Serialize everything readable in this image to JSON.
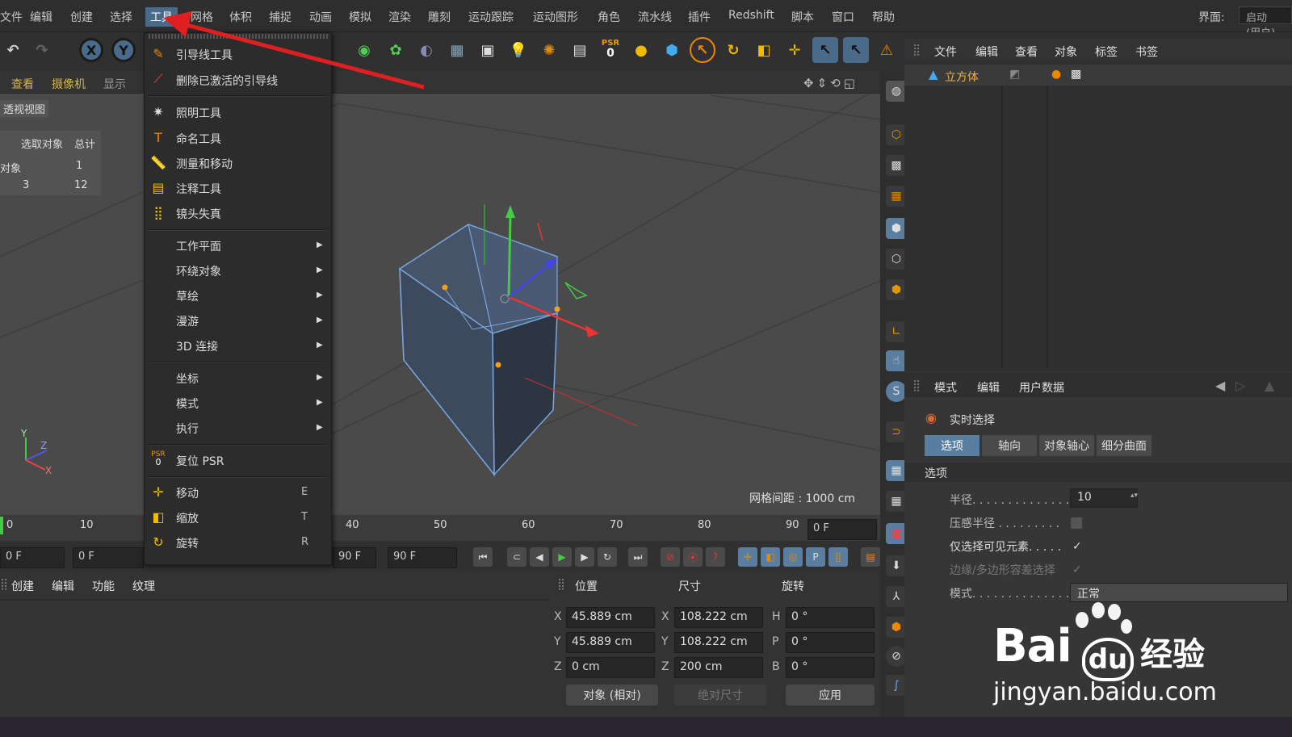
{
  "menubar": {
    "items": [
      "文件",
      "编辑",
      "创建",
      "选择",
      "工具",
      "网格",
      "体积",
      "捕捉",
      "动画",
      "模拟",
      "渲染",
      "雕刻",
      "运动跟踪",
      "运动图形",
      "角色",
      "流水线",
      "插件",
      "Redshift",
      "脚本",
      "窗口",
      "帮助"
    ],
    "interface_label": "界面:",
    "interface_value": "启动 (用户)"
  },
  "toolbar": {
    "psr_label": "PSR",
    "psr_value": "0"
  },
  "viewport": {
    "menu": [
      "查看",
      "摄像机",
      "显示"
    ],
    "view_name": "透视视图",
    "stats_header": [
      "选取对象",
      "总计"
    ],
    "stats_row1": [
      "对象",
      "1"
    ],
    "stats_row2": [
      "3",
      "12"
    ],
    "grid_label": "网格间距 : 1000 cm",
    "axis_labels": [
      "Y",
      "Z",
      "X"
    ]
  },
  "dropdown": {
    "group1": [
      {
        "label": "引导线工具"
      },
      {
        "label": "删除已激活的引导线"
      }
    ],
    "group2": [
      {
        "label": "照明工具"
      },
      {
        "label": "命名工具"
      },
      {
        "label": "测量和移动"
      },
      {
        "label": "注释工具"
      },
      {
        "label": "镜头失真"
      }
    ],
    "group3": [
      {
        "label": "工作平面"
      },
      {
        "label": "环绕对象"
      },
      {
        "label": "草绘"
      },
      {
        "label": "漫游"
      },
      {
        "label": "3D 连接"
      }
    ],
    "group4": [
      {
        "label": "坐标"
      },
      {
        "label": "模式"
      },
      {
        "label": "执行"
      }
    ],
    "reset_psr": "复位 PSR",
    "group5": [
      {
        "label": "移动",
        "key": "E"
      },
      {
        "label": "缩放",
        "key": "T"
      },
      {
        "label": "旋转",
        "key": "R"
      }
    ]
  },
  "object_manager": {
    "menu": [
      "文件",
      "编辑",
      "查看",
      "对象",
      "标签",
      "书签"
    ],
    "object_name": "立方体"
  },
  "attribute_manager": {
    "menu": [
      "模式",
      "编辑",
      "用户数据"
    ],
    "tool_title": "实时选择",
    "tabs": [
      "选项",
      "轴向",
      "对象轴心",
      "细分曲面"
    ],
    "section": "选项",
    "radius_label": "半径. . . . . . . . . . . . . . .",
    "radius_value": "10",
    "pressure_label": "压感半径 . . . . . . . . .",
    "visible_label": "仅选择可见元素. . . . .",
    "tolerance_label": "边缘/多边形容差选择",
    "mode_label": "模式. . . . . . . . . . . . . . .",
    "mode_value": "正常"
  },
  "timeline": {
    "ticks": [
      "0",
      "10",
      "40",
      "50",
      "60",
      "70",
      "80",
      "90"
    ],
    "current": "0 F"
  },
  "transport": {
    "start": "0 F",
    "min": "0 F",
    "max": "90 F",
    "end": "90 F"
  },
  "material_manager": {
    "menu": [
      "创建",
      "编辑",
      "功能",
      "纹理"
    ]
  },
  "coordinates": {
    "headers": [
      "位置",
      "尺寸",
      "旋转"
    ],
    "pos": [
      {
        "axis": "X",
        "value": "45.889 cm"
      },
      {
        "axis": "Y",
        "value": "45.889 cm"
      },
      {
        "axis": "Z",
        "value": "0 cm"
      }
    ],
    "size": [
      {
        "axis": "X",
        "value": "108.222 cm"
      },
      {
        "axis": "Y",
        "value": "108.222 cm"
      },
      {
        "axis": "Z",
        "value": "200 cm"
      }
    ],
    "rot": [
      {
        "axis": "H",
        "value": "0 °"
      },
      {
        "axis": "P",
        "value": "0 °"
      },
      {
        "axis": "B",
        "value": "0 °"
      }
    ],
    "mode_button": "对象 (相对)",
    "size_button": "绝对尺寸",
    "apply_button": "应用"
  },
  "watermark": {
    "brand": "Bai",
    "brand2": "经验",
    "url": "jingyan.baidu.com"
  },
  "colors": {
    "accent": "#5a7ea0",
    "arrow": "#e02020",
    "label_gold": "#d8b24a"
  }
}
